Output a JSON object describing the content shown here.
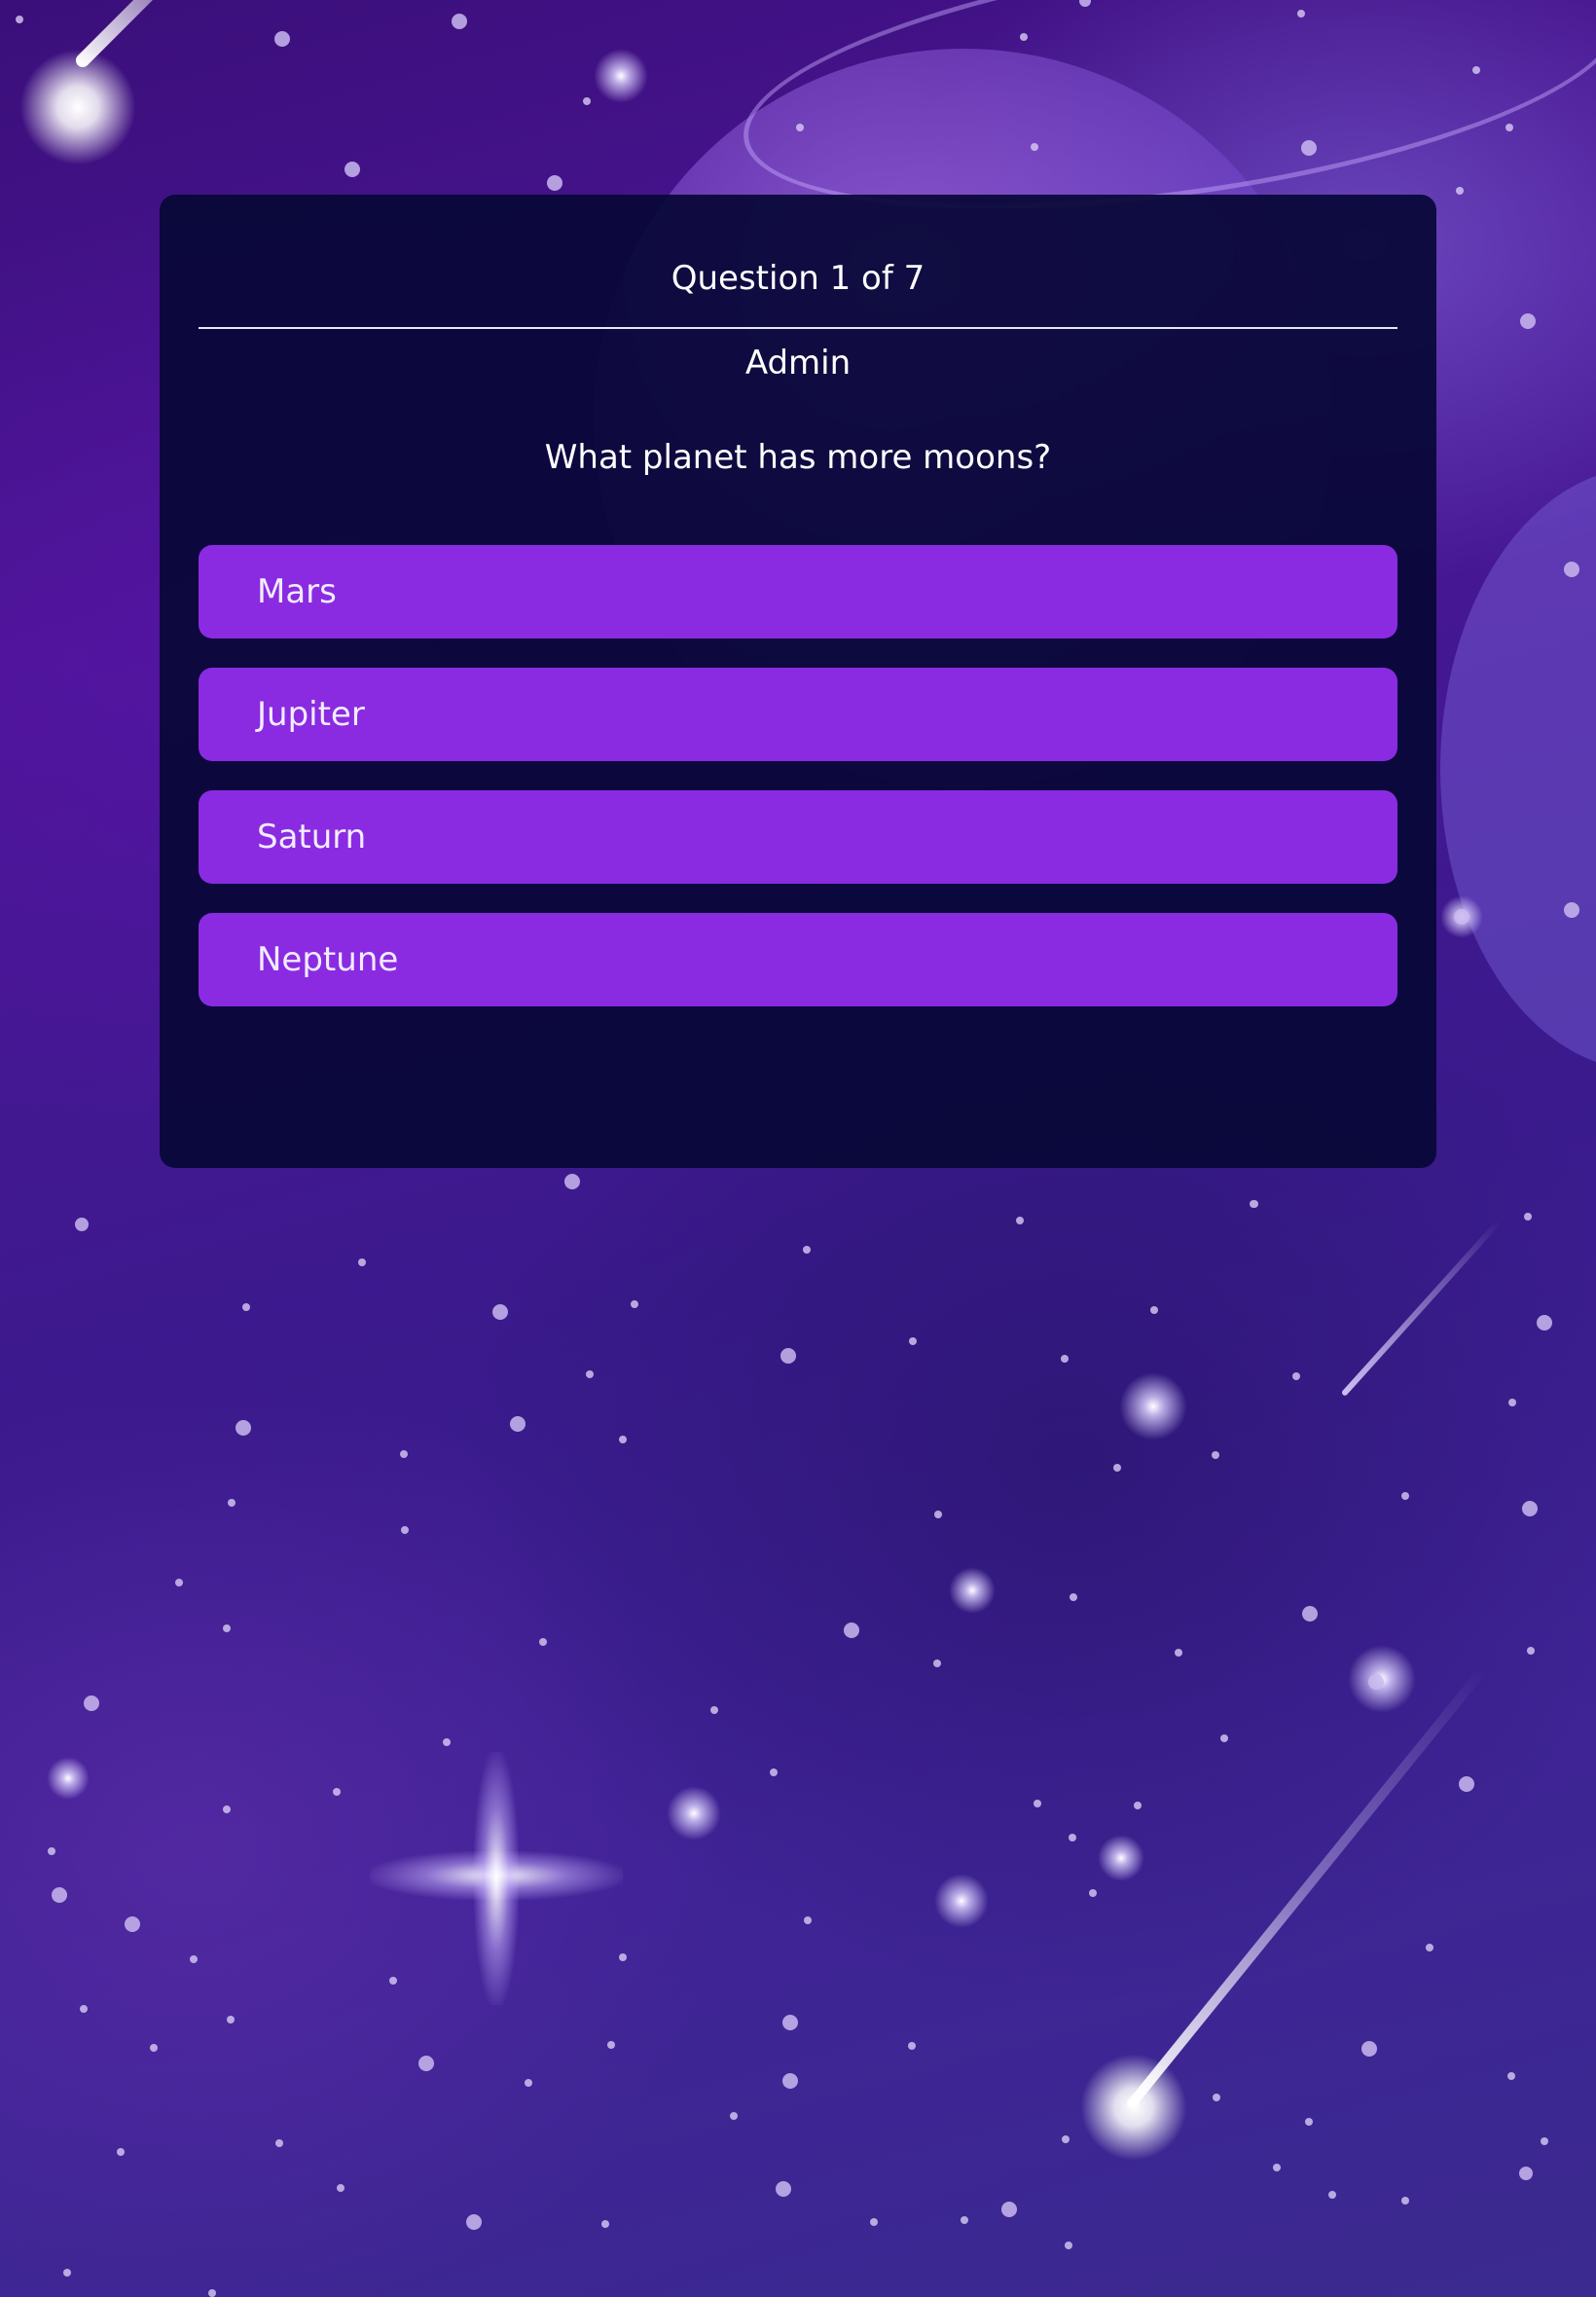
{
  "quiz": {
    "question_counter": "Question 1 of 7",
    "author": "Admin",
    "question_text": "What planet has more moons?",
    "answers": [
      {
        "label": "Mars"
      },
      {
        "label": "Jupiter"
      },
      {
        "label": "Saturn"
      },
      {
        "label": "Neptune"
      }
    ]
  },
  "colors": {
    "card_background": "#08083a",
    "answer_button": "#8a2be2",
    "text": "#ffffff",
    "background_primary": "#4c1597"
  }
}
